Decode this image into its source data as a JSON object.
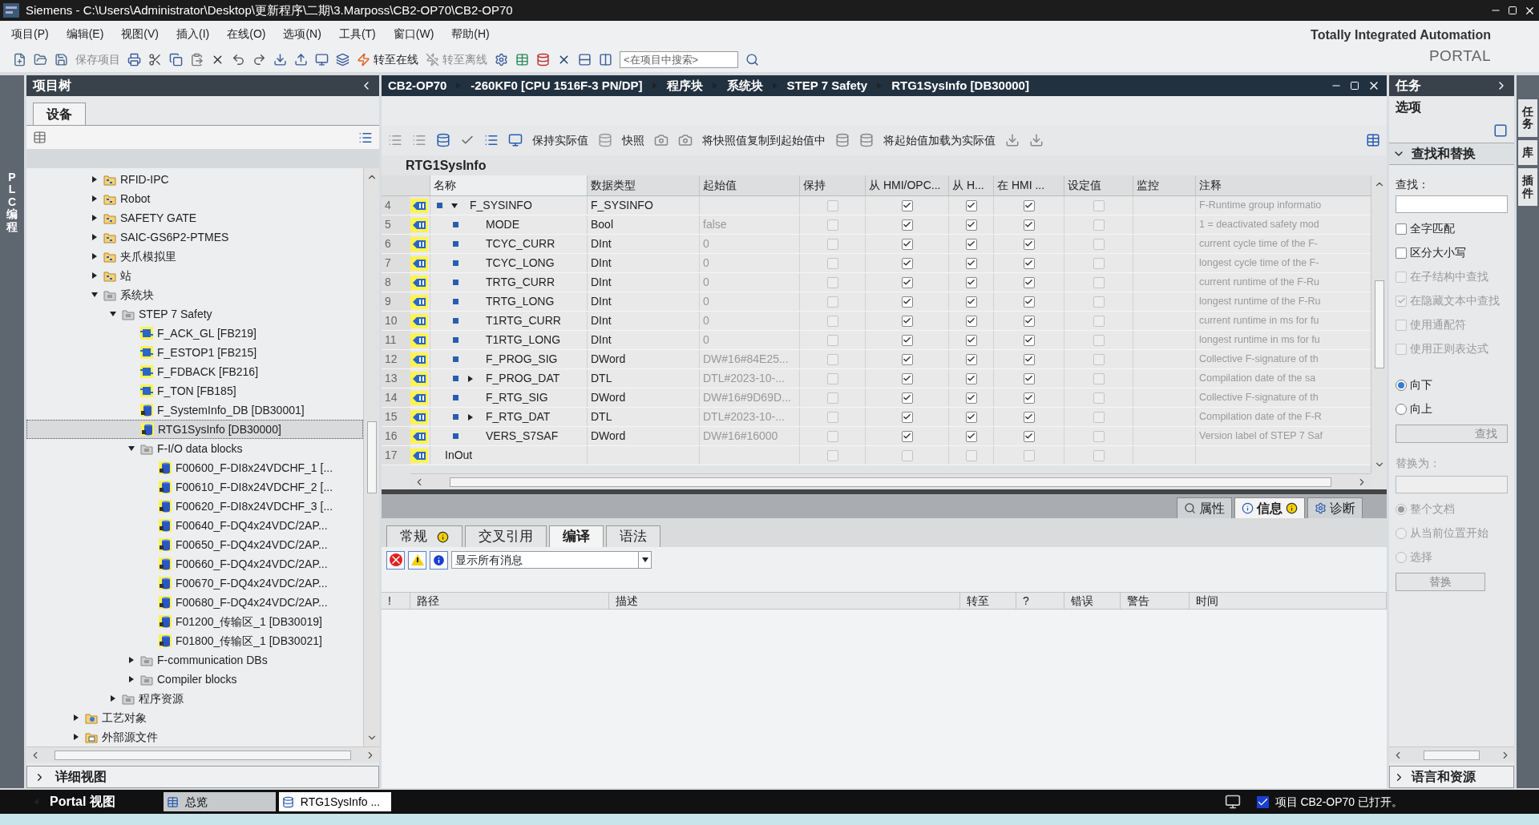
{
  "window": {
    "title": "Siemens  -  C:\\Users\\Administrator\\Desktop\\更新程序\\二期\\3.Marposs\\CB2-OP70\\CB2-OP70"
  },
  "menu": [
    "项目(P)",
    "编辑(E)",
    "视图(V)",
    "插入(I)",
    "在线(O)",
    "选项(N)",
    "工具(T)",
    "窗口(W)",
    "帮助(H)"
  ],
  "toolbar": {
    "save_label": "保存项目",
    "save_disabled": true,
    "go_online": "转至在线",
    "go_offline": "转至离线",
    "go_offline_disabled": true,
    "search_placeholder": "<在项目中搜索>"
  },
  "brand": {
    "line1": "Totally Integrated Automation",
    "line2": "PORTAL"
  },
  "side_strip": {
    "label": "PLC 编程"
  },
  "project_tree": {
    "title": "项目树",
    "tab": "设备",
    "items": [
      {
        "label": "RFID-IPC",
        "kind": "group",
        "expanded": false,
        "selected": false
      },
      {
        "label": "Robot",
        "kind": "group",
        "expanded": false,
        "selected": false
      },
      {
        "label": "SAFETY GATE",
        "kind": "group",
        "expanded": false,
        "selected": false
      },
      {
        "label": "SAIC-GS6P2-PTMES",
        "kind": "group",
        "expanded": false,
        "selected": false
      },
      {
        "label": "夹爪模拟里",
        "kind": "group",
        "expanded": false,
        "selected": false
      },
      {
        "label": "站",
        "kind": "group",
        "expanded": false,
        "selected": false
      },
      {
        "label": "系统块",
        "kind": "sysfolder",
        "expanded": true,
        "selected": false,
        "children": [
          {
            "label": "STEP 7 Safety",
            "kind": "sysfolder",
            "expanded": true,
            "selected": false,
            "children": [
              {
                "label": "F_ACK_GL [FB219]",
                "kind": "fb",
                "selected": false
              },
              {
                "label": "F_ESTOP1 [FB215]",
                "kind": "fb",
                "selected": false
              },
              {
                "label": "F_FDBACK [FB216]",
                "kind": "fb",
                "selected": false
              },
              {
                "label": "F_TON [FB185]",
                "kind": "fb",
                "selected": false
              },
              {
                "label": "F_SystemInfo_DB [DB30001]",
                "kind": "db",
                "selected": false
              },
              {
                "label": "RTG1SysInfo [DB30000]",
                "kind": "db",
                "selected": true
              },
              {
                "label": "F-I/O data blocks",
                "kind": "sysfolder",
                "expanded": true,
                "selected": false,
                "children": [
                  {
                    "label": "F00600_F-DI8x24VDCHF_1 [...",
                    "kind": "db",
                    "selected": false
                  },
                  {
                    "label": "F00610_F-DI8x24VDCHF_2 [...",
                    "kind": "db",
                    "selected": false
                  },
                  {
                    "label": "F00620_F-DI8x24VDCHF_3 [...",
                    "kind": "db",
                    "selected": false
                  },
                  {
                    "label": "F00640_F-DQ4x24VDC/2AP...",
                    "kind": "db",
                    "selected": false
                  },
                  {
                    "label": "F00650_F-DQ4x24VDC/2AP...",
                    "kind": "db",
                    "selected": false
                  },
                  {
                    "label": "F00660_F-DQ4x24VDC/2AP...",
                    "kind": "db",
                    "selected": false
                  },
                  {
                    "label": "F00670_F-DQ4x24VDC/2AP...",
                    "kind": "db",
                    "selected": false
                  },
                  {
                    "label": "F00680_F-DQ4x24VDC/2AP...",
                    "kind": "db",
                    "selected": false
                  },
                  {
                    "label": "F01200_传输区_1 [DB30019]",
                    "kind": "db",
                    "selected": false
                  },
                  {
                    "label": "F01800_传输区_1 [DB30021]",
                    "kind": "db",
                    "selected": false
                  }
                ]
              },
              {
                "label": "F-communication DBs",
                "kind": "sysfolder",
                "expanded": false,
                "selected": false
              },
              {
                "label": "Compiler blocks",
                "kind": "sysfolder",
                "expanded": false,
                "selected": false
              }
            ]
          },
          {
            "label": "程序资源",
            "kind": "sysfolder",
            "expanded": false,
            "selected": false
          }
        ]
      },
      {
        "label": "工艺对象",
        "kind": "tech",
        "expanded": false,
        "selected": false,
        "outer": true
      },
      {
        "label": "外部源文件",
        "kind": "source",
        "expanded": false,
        "selected": false,
        "outer": true
      }
    ]
  },
  "detail_view": {
    "label": "详细视图"
  },
  "editor": {
    "breadcrumb": [
      "CB2-OP70",
      "-260KF0 [CPU 1516F-3 PN/DP]",
      "程序块",
      "系统块",
      "STEP 7 Safety",
      "RTG1SysInfo [DB30000]"
    ],
    "toolbar_labels": [
      "保持实际值",
      "快照",
      "将快照值复制到起始值中",
      "将起始值加载为实际值"
    ],
    "block_title": "RTG1SysInfo",
    "columns": [
      "名称",
      "数据类型",
      "起始值",
      "保持",
      "从 HMI/OPC...",
      "从 H...",
      "在 HMI ...",
      "设定值",
      "监控",
      "注释"
    ],
    "rows": [
      {
        "num": "4",
        "name": "F_SYSINFO",
        "type": "F_SYSINFO",
        "kind": "struct",
        "expanded": true,
        "checks": [
          false,
          true,
          true,
          true,
          false
        ],
        "comment": "F-Runtime group informatio",
        "children": [
          {
            "num": "5",
            "name": "MODE",
            "type": "Bool",
            "start": "false",
            "checks": [
              false,
              true,
              true,
              true,
              false
            ],
            "comment": "1 = deactivated safety mod"
          },
          {
            "num": "6",
            "name": "TCYC_CURR",
            "type": "DInt",
            "start": "0",
            "checks": [
              false,
              true,
              true,
              true,
              false
            ],
            "comment": "current cycle time of the F-"
          },
          {
            "num": "7",
            "name": "TCYC_LONG",
            "type": "DInt",
            "start": "0",
            "checks": [
              false,
              true,
              true,
              true,
              false
            ],
            "comment": "longest cycle time of the F-"
          },
          {
            "num": "8",
            "name": "TRTG_CURR",
            "type": "DInt",
            "start": "0",
            "checks": [
              false,
              true,
              true,
              true,
              false
            ],
            "comment": "current runtime of the F-Ru"
          },
          {
            "num": "9",
            "name": "TRTG_LONG",
            "type": "DInt",
            "start": "0",
            "checks": [
              false,
              true,
              true,
              true,
              false
            ],
            "comment": "longest runtime of the  F-Ru"
          },
          {
            "num": "10",
            "name": "T1RTG_CURR",
            "type": "DInt",
            "start": "0",
            "checks": [
              false,
              true,
              true,
              true,
              false
            ],
            "comment": "current runtime in ms for fu"
          },
          {
            "num": "11",
            "name": "T1RTG_LONG",
            "type": "DInt",
            "start": "0",
            "checks": [
              false,
              true,
              true,
              true,
              false
            ],
            "comment": "longest runtime in ms for fu"
          },
          {
            "num": "12",
            "name": "F_PROG_SIG",
            "type": "DWord",
            "start": "DW#16#84E25...",
            "checks": [
              false,
              true,
              true,
              true,
              false
            ],
            "comment": "Collective F-signature of th"
          },
          {
            "num": "13",
            "name": "F_PROG_DAT",
            "type": "DTL",
            "start": "DTL#2023-10-...",
            "expanded": false,
            "checks": [
              false,
              true,
              true,
              true,
              false
            ],
            "comment": "Compilation date of the sa"
          },
          {
            "num": "14",
            "name": "F_RTG_SIG",
            "type": "DWord",
            "start": "DW#16#9D69D...",
            "checks": [
              false,
              true,
              true,
              true,
              false
            ],
            "comment": "Collective F-signature of th"
          },
          {
            "num": "15",
            "name": "F_RTG_DAT",
            "type": "DTL",
            "start": "DTL#2023-10-...",
            "expanded": false,
            "checks": [
              false,
              true,
              true,
              true,
              false
            ],
            "comment": "Compilation date of the F-R"
          },
          {
            "num": "16",
            "name": "VERS_S7SAF",
            "type": "DWord",
            "start": "DW#16#16000",
            "checks": [
              false,
              true,
              true,
              true,
              false
            ],
            "comment": "Version label of STEP 7 Saf"
          }
        ]
      },
      {
        "num": "17",
        "name": "InOut",
        "kind": "section",
        "checks": [
          false,
          false,
          false,
          false,
          false
        ]
      }
    ]
  },
  "inspector": {
    "tabs": [
      {
        "label": "属性",
        "selected": false,
        "info": false
      },
      {
        "label": "信息",
        "selected": true,
        "info": true
      },
      {
        "label": "诊断",
        "selected": false,
        "info": false
      }
    ],
    "subtabs": [
      {
        "label": "常规",
        "selected": false,
        "info": true
      },
      {
        "label": "交叉引用",
        "selected": false,
        "info": false
      },
      {
        "label": "编译",
        "selected": true,
        "info": false
      },
      {
        "label": "语法",
        "selected": false,
        "info": false
      }
    ],
    "filter": "显示所有消息",
    "columns": [
      "!",
      "路径",
      "描述",
      "转至",
      "?",
      "错误",
      "警告",
      "时间"
    ]
  },
  "tasks": {
    "title": "任务",
    "options_label": "选项",
    "section": "查找和替换",
    "find_label": "查找：",
    "options": [
      {
        "label": "全字匹配",
        "checked": false,
        "disabled": false
      },
      {
        "label": "区分大小写",
        "checked": false,
        "disabled": false
      },
      {
        "label": "在子结构中查找",
        "checked": false,
        "disabled": true
      },
      {
        "label": "在隐藏文本中查找",
        "checked": true,
        "disabled": true
      },
      {
        "label": "使用通配符",
        "checked": false,
        "disabled": true
      },
      {
        "label": "使用正则表达式",
        "checked": false,
        "disabled": true
      }
    ],
    "directions": [
      {
        "label": "向下",
        "selected": true
      },
      {
        "label": "向上",
        "selected": false
      }
    ],
    "find_button": "查找",
    "replace_label": "替换为：",
    "replace_scopes": [
      {
        "label": "整个文档",
        "selected": true
      },
      {
        "label": "从当前位置开始",
        "selected": false
      },
      {
        "label": "选择",
        "selected": false
      }
    ],
    "replace_button": "替换",
    "footer": "语言和资源",
    "side_tabs": [
      "任务",
      "库",
      "插件"
    ]
  },
  "taskbar": {
    "portal": "Portal 视图",
    "tabs": [
      {
        "label": "总览",
        "selected": false
      },
      {
        "label": "RTG1SysInfo ...",
        "selected": true
      }
    ],
    "status": "项目 CB2-OP70 已打开。"
  }
}
